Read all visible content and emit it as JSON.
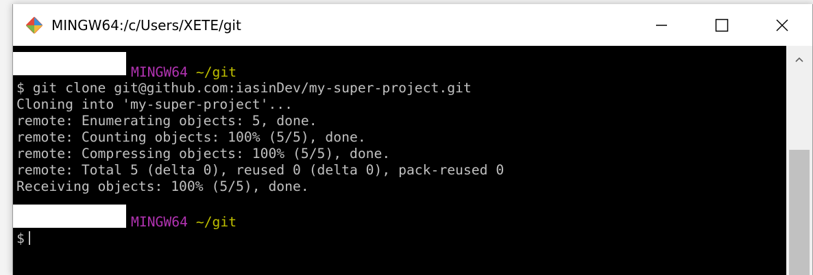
{
  "window": {
    "title": "MINGW64:/c/Users/XETE/git"
  },
  "terminal": {
    "prompt1": {
      "host": "MINGW64",
      "path": "~/git"
    },
    "command": "$ git clone git@github.com:iasinDev/my-super-project.git",
    "output": [
      "Cloning into 'my-super-project'...",
      "remote: Enumerating objects: 5, done.",
      "remote: Counting objects: 100% (5/5), done.",
      "remote: Compressing objects: 100% (5/5), done.",
      "remote: Total 5 (delta 0), reused 0 (delta 0), pack-reused 0",
      "Receiving objects: 100% (5/5), done."
    ],
    "prompt2": {
      "host": "MINGW64",
      "path": "~/git"
    },
    "input_prompt": "$"
  },
  "colors": {
    "terminal_bg": "#000000",
    "terminal_text": "#c0c0c0",
    "prompt_host": "#b133b1",
    "prompt_path": "#bfbf00"
  }
}
